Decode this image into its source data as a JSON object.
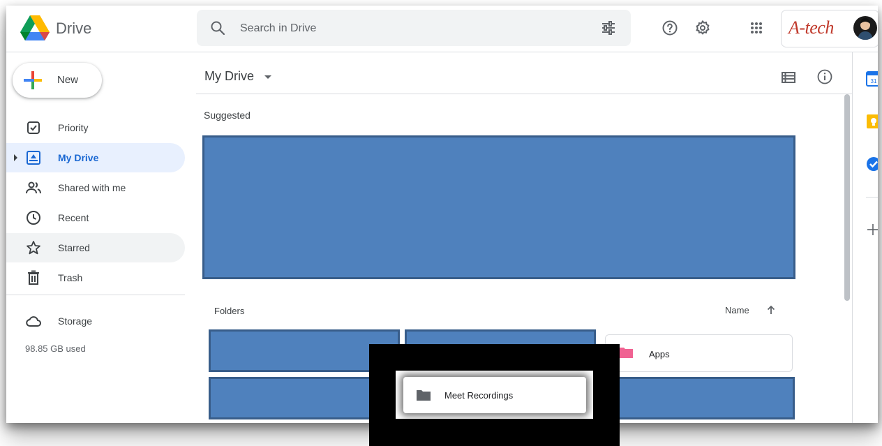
{
  "app": {
    "name": "Drive"
  },
  "search": {
    "placeholder": "Search in Drive"
  },
  "brand": {
    "text": "A-tech"
  },
  "sidebar": {
    "new_label": "New",
    "items": [
      {
        "label": "Priority",
        "icon": "priority-icon"
      },
      {
        "label": "My Drive",
        "icon": "my-drive-icon",
        "active": true
      },
      {
        "label": "Shared with me",
        "icon": "shared-icon"
      },
      {
        "label": "Recent",
        "icon": "clock-icon"
      },
      {
        "label": "Starred",
        "icon": "star-icon"
      },
      {
        "label": "Trash",
        "icon": "trash-icon"
      }
    ],
    "storage_label": "Storage",
    "storage_used": "98.85 GB used"
  },
  "main": {
    "title": "My Drive",
    "suggested_label": "Suggested",
    "folders_label": "Folders",
    "sort_label": "Name",
    "folders": [
      {
        "name": "Apps",
        "color": "#f06292"
      },
      {
        "name": "Meet Recordings",
        "color": "#5f6368"
      }
    ]
  },
  "colors": {
    "redaction_fill": "#4f81bd",
    "redaction_border": "#385d8a",
    "accent": "#1967d2",
    "active_bg": "#e8f0fe"
  }
}
